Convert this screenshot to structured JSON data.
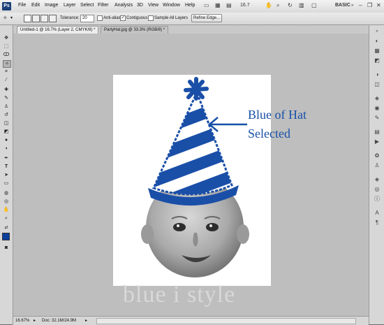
{
  "app": {
    "logo": "Ps"
  },
  "menu": [
    "File",
    "Edit",
    "Image",
    "Layer",
    "Select",
    "Filter",
    "Analysis",
    "3D",
    "View",
    "Window",
    "Help"
  ],
  "menubar_right": {
    "zoom": "16.7",
    "workspace": "BASIC"
  },
  "options": {
    "tolerance_label": "Tolerance:",
    "tolerance_value": "20",
    "anti_alias_label": "Anti-alias",
    "anti_alias_checked": false,
    "contiguous_label": "Contiguous",
    "contiguous_checked": true,
    "sample_all_label": "Sample All Layers",
    "sample_all_checked": false,
    "refine_label": "Refine Edge..."
  },
  "tabs": [
    {
      "label": "Untitled-1 @ 16.7% (Layer 2, CMYK/8) *",
      "active": true
    },
    {
      "label": "PartyHat.jpg @ 33.3% (RGB/8) *",
      "active": false
    }
  ],
  "annotation": {
    "line1": "Blue of Hat",
    "line2": "Selected",
    "color": "#1750a8"
  },
  "watermark": "blue i style",
  "status": {
    "zoom": "16.67%",
    "doc": "Doc: 32.1M/24.9M"
  },
  "colors": {
    "hat_blue": "#1a4fa8",
    "foreground": "#0b3f9e",
    "background": "#ffffff"
  }
}
